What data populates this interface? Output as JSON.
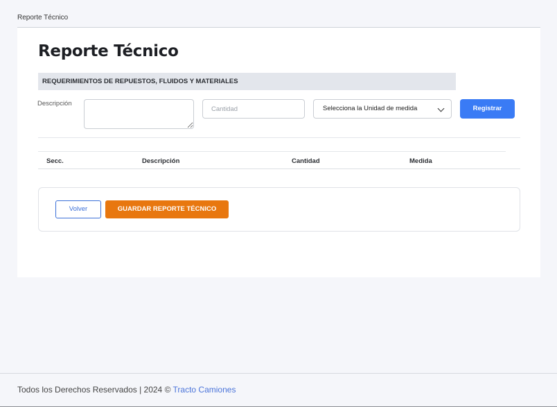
{
  "breadcrumb": "Reporte Técnico",
  "page_title": "Reporte Técnico",
  "section_header": "REQUERIMIENTOS DE REPUESTOS, FLUIDOS Y MATERIALES",
  "form": {
    "description_label": "Descripción",
    "description_value": "",
    "quantity_placeholder": "Cantidad",
    "unit_select_value": "Selecciona la Unidad de medida",
    "register_label": "Registrar"
  },
  "table": {
    "columns": [
      "Secc.",
      "Descripción",
      "Cantidad",
      "Medida"
    ],
    "rows": []
  },
  "actions": {
    "back_label": "Volver",
    "save_label": "GUARDAR REPORTE TÉCNICO"
  },
  "footer": {
    "text": "Todos los Derechos Reservados  | 2024 © ",
    "link": "Tracto Camiones"
  },
  "colors": {
    "primary": "#3a7bf5",
    "save_orange": "#e8770f",
    "section_bg": "#e3e6ec",
    "page_bg": "#f5f6fa"
  }
}
